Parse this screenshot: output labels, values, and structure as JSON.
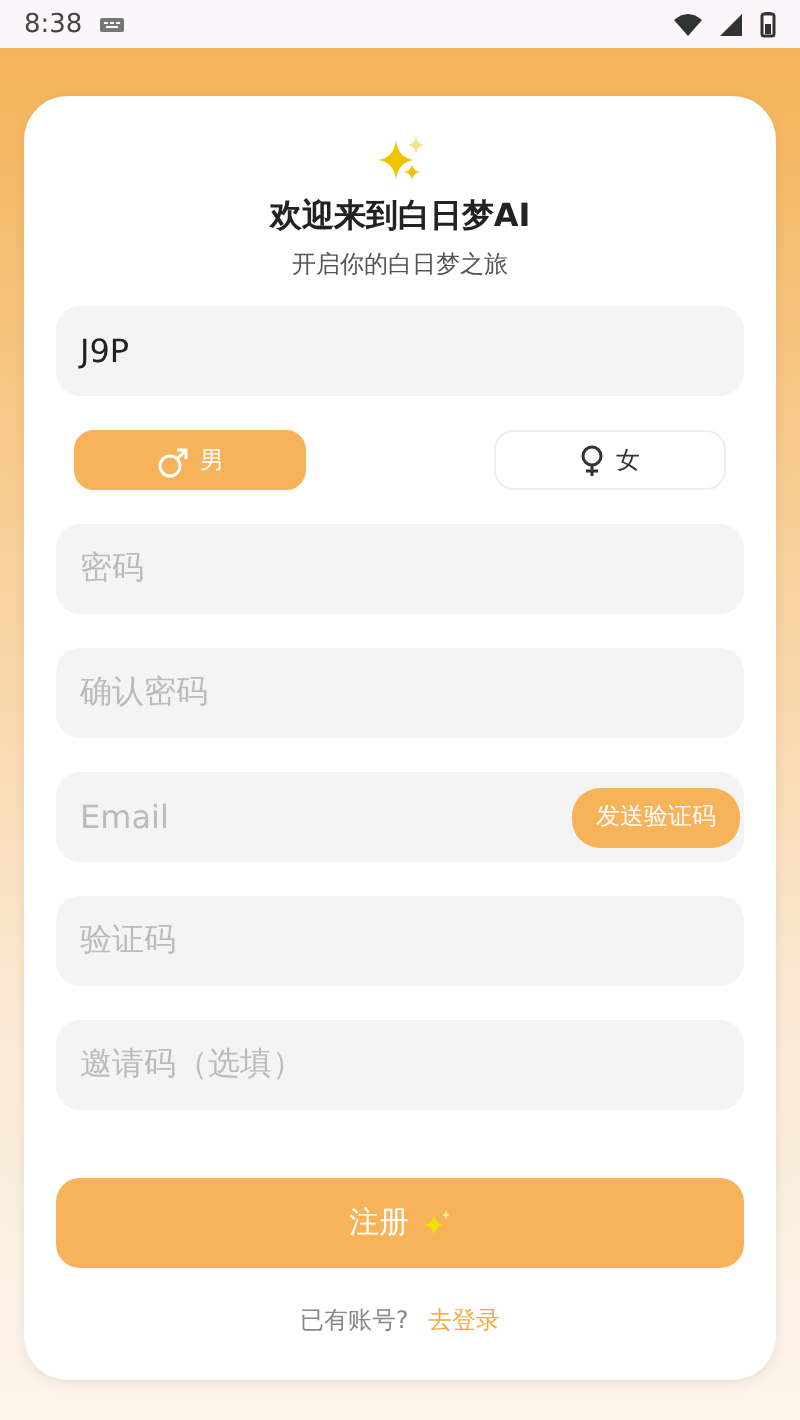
{
  "status_bar": {
    "time": "8:38"
  },
  "header": {
    "title": "欢迎来到白日梦AI",
    "subtitle": "开启你的白日梦之旅"
  },
  "username": {
    "value": "J9P"
  },
  "genders": [
    {
      "kind": "male",
      "label": "男",
      "selected": true
    },
    {
      "kind": "female",
      "label": "女",
      "selected": false
    }
  ],
  "fields": [
    {
      "placeholder": "密码"
    },
    {
      "placeholder": "确认密码"
    },
    {
      "placeholder": "Email",
      "button": "发送验证码"
    },
    {
      "placeholder": "验证码"
    },
    {
      "placeholder": "邀请码（选填）"
    }
  ],
  "submit": {
    "label": "注册"
  },
  "footer": {
    "text": "已有账号?",
    "link": "去登录"
  }
}
